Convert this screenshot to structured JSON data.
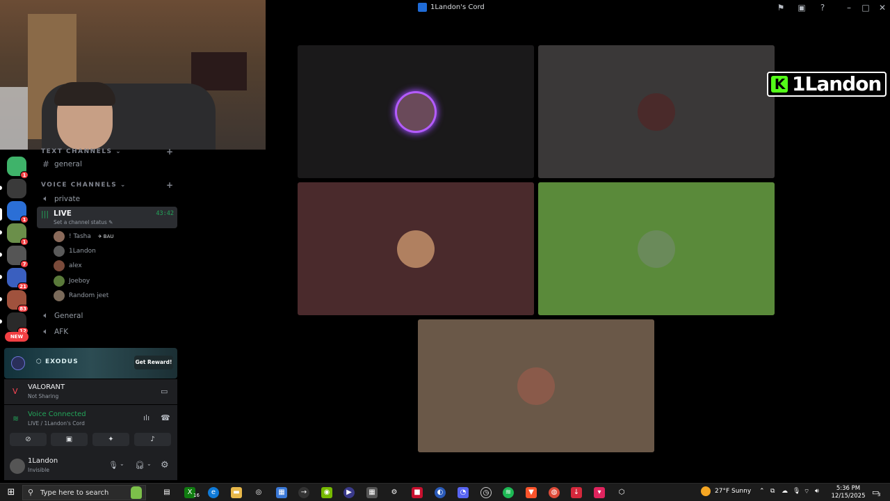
{
  "window": {
    "title": "1Landon's Cord"
  },
  "overlay": {
    "streamer_name": "1Landon",
    "platform_letter": "K"
  },
  "servers": [
    {
      "badge": "1",
      "color": "#3fb36a"
    },
    {
      "badge": "",
      "color": "#3a3a3a"
    },
    {
      "badge": "1",
      "color": "#2b6fd6"
    },
    {
      "badge": "1",
      "color": "#6b8f4a"
    },
    {
      "badge": "7",
      "color": "#555555"
    },
    {
      "badge": "21",
      "color": "#3a5fbf"
    },
    {
      "badge": "83",
      "color": "#a0523d"
    },
    {
      "badge": "12",
      "color": "#2a2a2a"
    }
  ],
  "new_label": "NEW",
  "channels": {
    "text_category": "TEXT CHANNELS",
    "text": [
      "general"
    ],
    "voice_category": "VOICE CHANNELS",
    "voice_before": [
      "private"
    ],
    "live": {
      "name": "LIVE",
      "status": "Set a channel status",
      "timer": "43:42"
    },
    "members": [
      {
        "name": "! Tasha",
        "tag": "BAU",
        "color": "#8a6a5a"
      },
      {
        "name": "1Landon",
        "tag": "",
        "color": "#5a5a5a"
      },
      {
        "name": "alex",
        "tag": "",
        "color": "#7a4a3a"
      },
      {
        "name": "Joeboy",
        "tag": "",
        "color": "#5a7a3a"
      },
      {
        "name": "Random jeet",
        "tag": "",
        "color": "#7a6a5a"
      }
    ],
    "voice_after": [
      "General",
      "AFK"
    ]
  },
  "promo": {
    "brand": "EXODUS",
    "button": "Get Reward!"
  },
  "activity": {
    "game": "VALORANT",
    "status": "Not Sharing"
  },
  "voice": {
    "title": "Voice Connected",
    "subtitle": "LIVE / 1Landon's Cord"
  },
  "user": {
    "name": "1Landon",
    "status": "Invisible"
  },
  "tiles": [
    {
      "bg": "#1a191a",
      "avatar": "#6a4a5a",
      "ring": "#b45cff"
    },
    {
      "bg": "#3a3838",
      "avatar": "#4a2a2a",
      "ring": ""
    },
    {
      "bg": "#4a2a2c",
      "avatar": "#b08060",
      "ring": ""
    },
    {
      "bg": "#5a8a3a",
      "avatar": "#6a8a5a",
      "ring": ""
    },
    {
      "bg": "#6a5848",
      "avatar": "#8a5a4a",
      "ring": ""
    }
  ],
  "taskbar": {
    "search_placeholder": "Type here to search",
    "xbox_badge": "16",
    "weather": "27°F  Sunny",
    "time": "5:36 PM",
    "date": "12/15/2025",
    "notif_count": "3"
  }
}
